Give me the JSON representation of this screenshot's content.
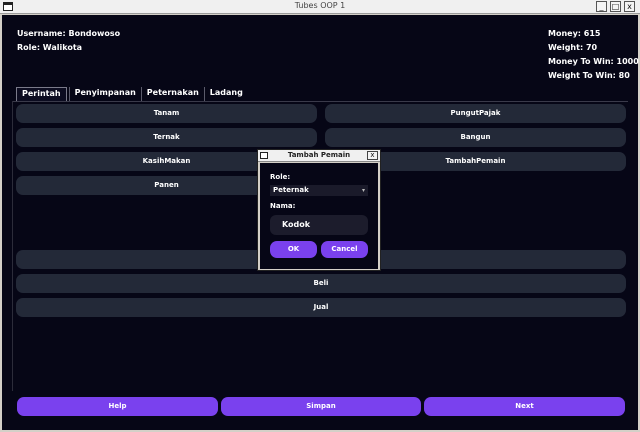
{
  "window": {
    "title": "Tubes OOP 1",
    "minimize": "_",
    "maximize": "□",
    "close": "x"
  },
  "user": {
    "username": "Username: Bondowoso",
    "role": "Role: Walikota"
  },
  "stats": {
    "money": "Money: 615",
    "weight": "Weight: 70",
    "money_to_win": "Money To Win: 1000",
    "weight_to_win": "Weight To Win: 80"
  },
  "tabs": [
    "Perintah",
    "Penyimpanan",
    "Peternakan",
    "Ladang"
  ],
  "commands": {
    "tanam": "Tanam",
    "pungut_pajak": "PungutPajak",
    "ternak": "Ternak",
    "bangun": "Bangun",
    "kasih_makan": "KasihMakan",
    "tambah_pemain": "TambahPemain",
    "panen": "Panen",
    "beli": "Beli",
    "jual": "Jual"
  },
  "bottom": {
    "help": "Help",
    "simpan": "Simpan",
    "next": "Next"
  },
  "dialog": {
    "title": "Tambah Pemain",
    "close": "x",
    "role_label": "Role:",
    "role_value": "Peternak",
    "nama_label": "Nama:",
    "nama_value": "Kodok",
    "ok": "OK",
    "cancel": "Cancel"
  },
  "colors": {
    "background": "#060616",
    "button": "#232938",
    "accent": "#7a41ee"
  }
}
